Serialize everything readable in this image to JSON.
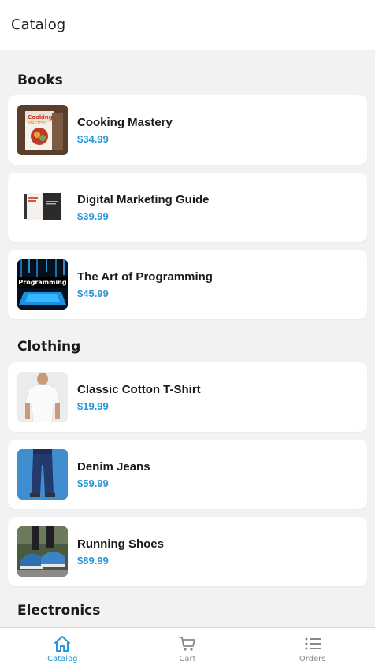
{
  "header": {
    "title": "Catalog"
  },
  "sections": [
    {
      "title": "Books",
      "items": [
        {
          "name": "Cooking Mastery",
          "price": "$34.99",
          "thumb_icon": "cooking-book-cover"
        },
        {
          "name": "Digital Marketing Guide",
          "price": "$39.99",
          "thumb_icon": "marketing-book-cover"
        },
        {
          "name": "The Art of Programming",
          "price": "$45.99",
          "thumb_icon": "programming-book-cover",
          "thumb_text": "Programming"
        }
      ]
    },
    {
      "title": "Clothing",
      "items": [
        {
          "name": "Classic Cotton T-Shirt",
          "price": "$19.99",
          "thumb_icon": "tshirt-photo"
        },
        {
          "name": "Denim Jeans",
          "price": "$59.99",
          "thumb_icon": "jeans-photo"
        },
        {
          "name": "Running Shoes",
          "price": "$89.99",
          "thumb_icon": "shoes-photo"
        }
      ]
    },
    {
      "title": "Electronics",
      "items": []
    }
  ],
  "tabbar": {
    "tabs": [
      {
        "label": "Catalog",
        "icon": "home-icon",
        "active": true
      },
      {
        "label": "Cart",
        "icon": "cart-icon",
        "active": false
      },
      {
        "label": "Orders",
        "icon": "list-icon",
        "active": false
      }
    ]
  },
  "colors": {
    "accent": "#2596d8",
    "background": "#f2f2f2",
    "card": "#ffffff"
  }
}
